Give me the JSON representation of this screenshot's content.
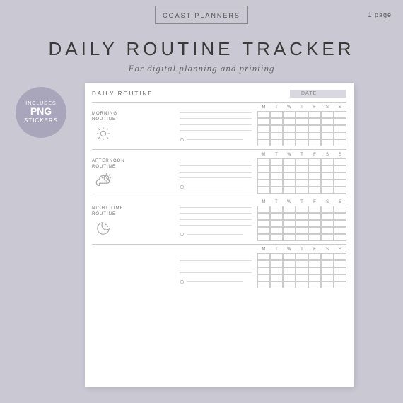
{
  "topbar": {
    "brand": "COAST PLANNERS",
    "page_count": "1 page"
  },
  "title": "DAILY ROUTINE TRACKER",
  "subtitle": "For digital planning and printing",
  "badge": {
    "includes": "INCLUDES",
    "main": "PNG",
    "stickers": "STICKERS"
  },
  "planner": {
    "title": "DAILY ROUTINE",
    "date_label": "DATE",
    "days": [
      "M",
      "T",
      "W",
      "T",
      "F",
      "S",
      "S"
    ],
    "sections": [
      {
        "id": "morning",
        "label": "MORNING\nROUTINE",
        "icon": "sun",
        "lines": 3
      },
      {
        "id": "afternoon",
        "label": "AFTERNOON\nROUTINE",
        "icon": "cloud-sun",
        "lines": 3
      },
      {
        "id": "night",
        "label": "NIGHT TIME\nROUTINE",
        "icon": "moon",
        "lines": 3
      },
      {
        "id": "extra",
        "label": "",
        "icon": "",
        "lines": 3
      }
    ]
  }
}
